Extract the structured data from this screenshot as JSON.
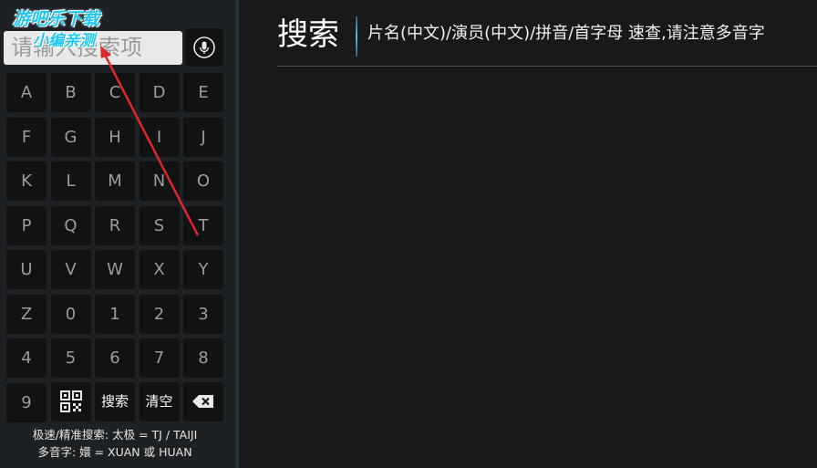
{
  "search": {
    "placeholder": "请输入搜索项",
    "title": "搜索",
    "hint": "片名(中文)/演员(中文)/拼音/首字母 速查,请注意多音字"
  },
  "keypad": {
    "keys": [
      "A",
      "B",
      "C",
      "D",
      "E",
      "F",
      "G",
      "H",
      "I",
      "J",
      "K",
      "L",
      "M",
      "N",
      "O",
      "P",
      "Q",
      "R",
      "S",
      "T",
      "U",
      "V",
      "W",
      "X",
      "Y",
      "Z",
      "0",
      "1",
      "2",
      "3",
      "4",
      "5",
      "6",
      "7",
      "8",
      "9"
    ],
    "search_key": "搜索",
    "clear_key": "清空"
  },
  "help": {
    "line1": "极速/精准搜索: 太极 = TJ / TAIJI",
    "line2": "多音字: 嬛 = XUAN 或 HUAN"
  },
  "watermark": {
    "line1": "游吧乐下载",
    "line2": "小编亲测"
  },
  "icons": {
    "voice": "mic-icon",
    "qr": "qr-code-icon",
    "backspace": "backspace-icon"
  },
  "colors": {
    "accent": "#5dbde0",
    "key_bg": "#101214",
    "annotation": "#e0262b"
  }
}
